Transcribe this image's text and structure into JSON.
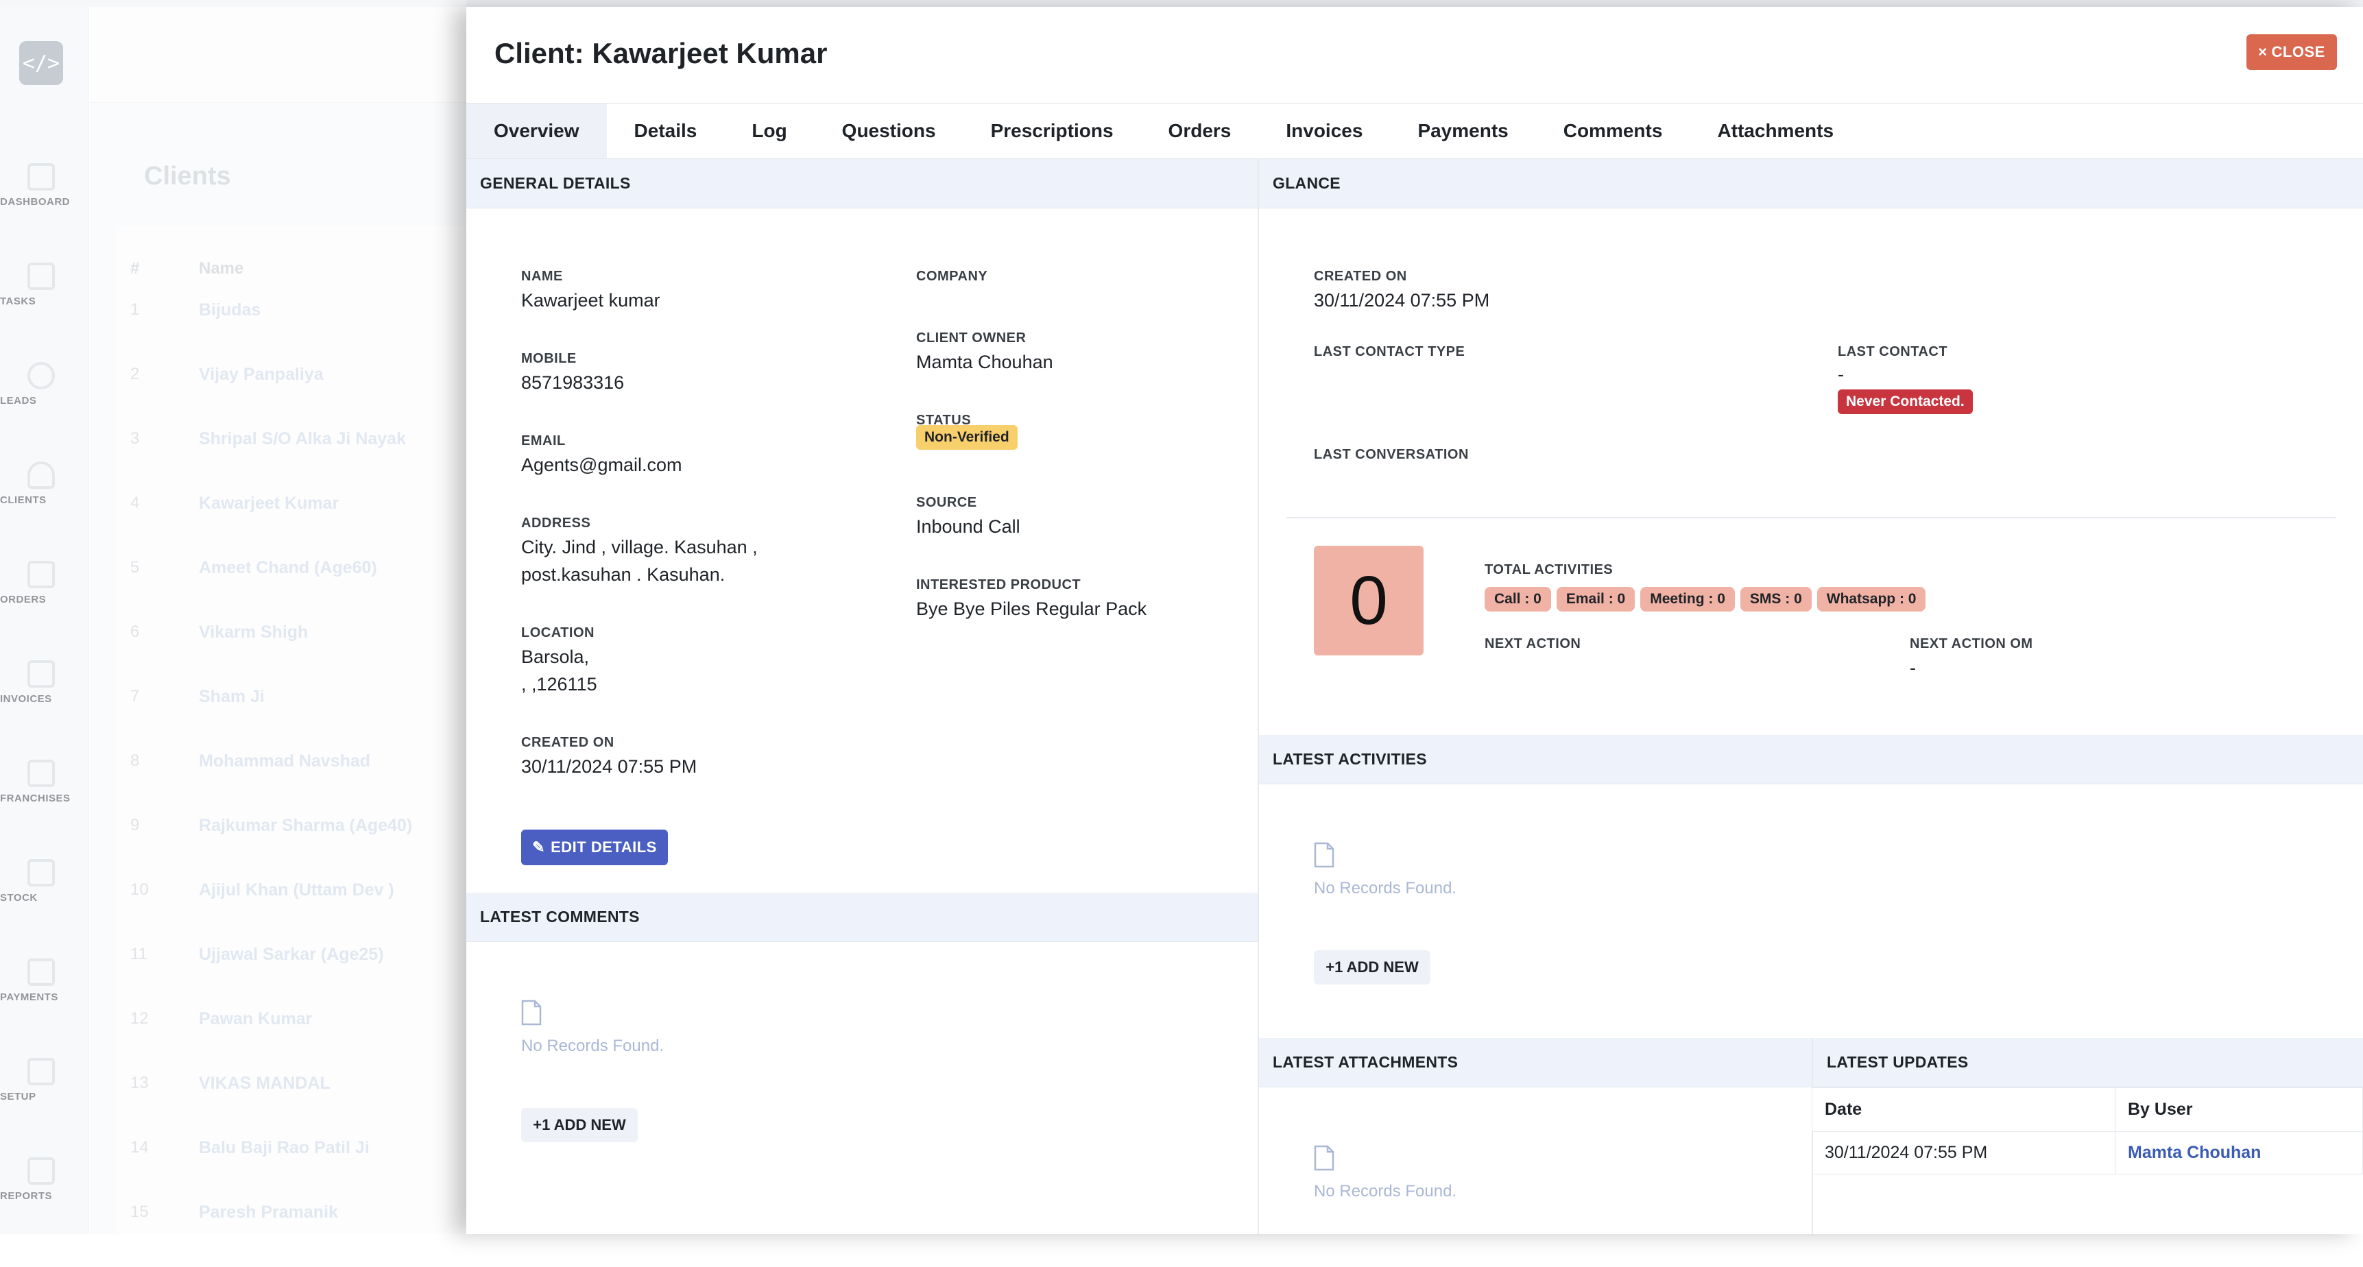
{
  "background": {
    "logo_glyph": "</>",
    "nav": [
      {
        "label": "DASHBOARD",
        "icon": "dashboard-icon"
      },
      {
        "label": "TASKS",
        "icon": "tasks-icon"
      },
      {
        "label": "LEADS",
        "icon": "headset-icon"
      },
      {
        "label": "CLIENTS",
        "icon": "user-icon"
      },
      {
        "label": "ORDERS",
        "icon": "orders-icon"
      },
      {
        "label": "INVOICES",
        "icon": "invoice-icon"
      },
      {
        "label": "FRANCHISES",
        "icon": "id-card-icon"
      },
      {
        "label": "STOCK",
        "icon": "stock-icon"
      },
      {
        "label": "PAYMENTS",
        "icon": "credit-card-icon"
      },
      {
        "label": "SETUP",
        "icon": "sliders-icon"
      },
      {
        "label": "REPORTS",
        "icon": "chart-icon"
      }
    ],
    "page_title": "Clients",
    "table_headers": {
      "num": "#",
      "name": "Name"
    },
    "rows": [
      {
        "num": "1",
        "name": "Bijudas"
      },
      {
        "num": "2",
        "name": "Vijay Panpaliya"
      },
      {
        "num": "3",
        "name": "Shripal S/O Alka Ji Nayak"
      },
      {
        "num": "4",
        "name": "Kawarjeet Kumar"
      },
      {
        "num": "5",
        "name": "Ameet Chand (Age60)"
      },
      {
        "num": "6",
        "name": "Vikarm Shigh"
      },
      {
        "num": "7",
        "name": "Sham Ji"
      },
      {
        "num": "8",
        "name": "Mohammad Navshad"
      },
      {
        "num": "9",
        "name": "Rajkumar Sharma (Age40)"
      },
      {
        "num": "10",
        "name": "Ajijul Khan (Uttam Dev )"
      },
      {
        "num": "11",
        "name": "Ujjawal Sarkar (Age25)"
      },
      {
        "num": "12",
        "name": "Pawan Kumar"
      },
      {
        "num": "13",
        "name": "VIKAS MANDAL"
      },
      {
        "num": "14",
        "name": "Balu Baji Rao Patil Ji"
      },
      {
        "num": "15",
        "name": "Paresh Pramanik"
      }
    ]
  },
  "panel": {
    "title": "Client: Kawarjeet Kumar",
    "close_label": "CLOSE",
    "close_glyph": "×",
    "tabs": [
      "Overview",
      "Details",
      "Log",
      "Questions",
      "Prescriptions",
      "Orders",
      "Invoices",
      "Payments",
      "Comments",
      "Attachments"
    ],
    "active_tab": "Overview"
  },
  "general": {
    "heading": "GENERAL DETAILS",
    "name_label": "NAME",
    "name": "Kawarjeet kumar",
    "mobile_label": "MOBILE",
    "mobile": "8571983316",
    "email_label": "EMAIL",
    "email": "Agents@gmail.com",
    "address_label": "ADDRESS",
    "address_line1": "City. Jind , village. Kasuhan ,",
    "address_line2": "post.kasuhan . Kasuhan.",
    "location_label": "LOCATION",
    "location_line1": "Barsola,",
    "location_line2": ", ,126115",
    "created_label": "CREATED ON",
    "created": "30/11/2024 07:55 PM",
    "company_label": "COMPANY",
    "company": "",
    "owner_label": "CLIENT OWNER",
    "owner": "Mamta Chouhan",
    "status_label": "STATUS",
    "status": "Non-Verified",
    "source_label": "SOURCE",
    "source": "Inbound Call",
    "product_label": "INTERESTED PRODUCT",
    "product": "Bye Bye Piles Regular Pack",
    "edit_label": "EDIT DETAILS"
  },
  "comments": {
    "heading": "LATEST COMMENTS",
    "empty": "No Records Found.",
    "add_label": "+1 ADD NEW"
  },
  "glance": {
    "heading": "GLANCE",
    "created_label": "CREATED ON",
    "created": "30/11/2024 07:55 PM",
    "last_contact_type_label": "LAST CONTACT TYPE",
    "last_contact_label": "LAST CONTACT",
    "last_contact": "-",
    "never_badge": "Never Contacted.",
    "last_conversation_label": "LAST CONVERSATION",
    "total_count": "0",
    "total_label": "TOTAL ACTIVITIES",
    "pills": [
      "Call : 0",
      "Email : 0",
      "Meeting : 0",
      "SMS : 0",
      "Whatsapp : 0"
    ],
    "next_action_label": "NEXT ACTION",
    "next_action_on_label": "NEXT ACTION OM",
    "next_action_on": "-"
  },
  "activities": {
    "heading": "LATEST ACTIVITIES",
    "empty": "No Records Found.",
    "add_label": "+1 ADD NEW"
  },
  "attachments": {
    "heading": "LATEST ATTACHMENTS",
    "empty": "No Records Found."
  },
  "updates": {
    "heading": "LATEST UPDATES",
    "col_date": "Date",
    "col_user": "By User",
    "rows": [
      {
        "date": "30/11/2024 07:55 PM",
        "user": "Mamta Chouhan"
      }
    ]
  },
  "colors": {
    "accent": "#4a5fc1",
    "close": "#d9684f",
    "status_badge": "#f7cf6b",
    "never_badge": "#c9353f",
    "activity_pill": "#f0b2a4"
  }
}
